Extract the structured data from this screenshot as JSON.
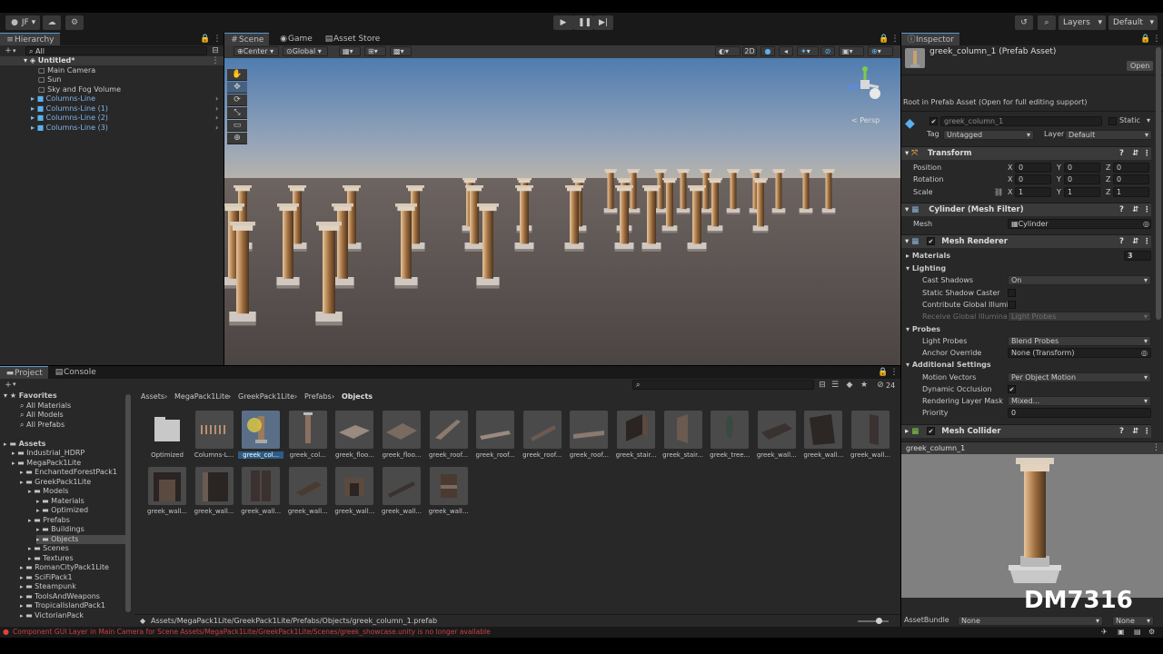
{
  "topbar": {
    "account": "JF",
    "layers": "Layers",
    "layout": "Default"
  },
  "hierarchy": {
    "tab": "Hierarchy",
    "search_placeholder": "All",
    "scene": "Untitled*",
    "items": [
      "Main Camera",
      "Sun",
      "Sky and Fog Volume",
      "Columns-Line",
      "Columns-Line (1)",
      "Columns-Line (2)",
      "Columns-Line (3)"
    ]
  },
  "scene": {
    "tabs": [
      "Scene",
      "Game",
      "Asset Store"
    ],
    "pivot": "Center",
    "space": "Global",
    "mode2d": "2D",
    "gizmo_label": "< Persp"
  },
  "project": {
    "tabs": [
      "Project",
      "Console"
    ],
    "asset_count": "24",
    "breadcrumb": [
      "Assets",
      "MegaPack1Lite",
      "GreekPack1Lite",
      "Prefabs",
      "Objects"
    ],
    "favorites": {
      "label": "Favorites",
      "items": [
        "All Materials",
        "All Models",
        "All Prefabs"
      ]
    },
    "tree": [
      {
        "label": "Assets",
        "indent": 0
      },
      {
        "label": "Industrial_HDRP",
        "indent": 1
      },
      {
        "label": "MegaPack1Lite",
        "indent": 1
      },
      {
        "label": "EnchantedForestPack1",
        "indent": 2
      },
      {
        "label": "GreekPack1Lite",
        "indent": 2
      },
      {
        "label": "Models",
        "indent": 3
      },
      {
        "label": "Materials",
        "indent": 4
      },
      {
        "label": "Optimized",
        "indent": 4
      },
      {
        "label": "Prefabs",
        "indent": 3
      },
      {
        "label": "Buildings",
        "indent": 4
      },
      {
        "label": "Objects",
        "indent": 4
      },
      {
        "label": "Scenes",
        "indent": 3
      },
      {
        "label": "Textures",
        "indent": 3
      },
      {
        "label": "RomanCityPack1Lite",
        "indent": 2
      },
      {
        "label": "SciFiPack1",
        "indent": 2
      },
      {
        "label": "Steampunk",
        "indent": 2
      },
      {
        "label": "ToolsAndWeapons",
        "indent": 2
      },
      {
        "label": "TropicalIslandPack1",
        "indent": 2
      },
      {
        "label": "VictorianPack",
        "indent": 2
      }
    ],
    "assets_row1": [
      "Optimized",
      "Columns-L...",
      "greek_col...",
      "greek_col...",
      "greek_floo...",
      "greek_floo...",
      "greek_roof...",
      "greek_roof...",
      "greek_roof...",
      "greek_roof...",
      "greek_stair...",
      "greek_stair...",
      "greek_tree...",
      "greek_wall...",
      "greek_wall...",
      "greek_wall..."
    ],
    "assets_row2": [
      "greek_wall...",
      "greek_wall...",
      "greek_wall...",
      "greek_wall...",
      "greek_wall...",
      "greek_wall...",
      "greek_wall..."
    ],
    "selected_path": "Assets/MegaPack1Lite/GreekPack1Lite/Prefabs/Objects/greek_column_1.prefab"
  },
  "inspector": {
    "tab": "Inspector",
    "asset_title": "greek_column_1 (Prefab Asset)",
    "open_button": "Open",
    "root_note": "Root in Prefab Asset (Open for full editing support)",
    "object_name": "greek_column_1",
    "static_label": "Static",
    "tag_label": "Tag",
    "tag_value": "Untagged",
    "layer_label": "Layer",
    "layer_value": "Default",
    "transform": {
      "title": "Transform",
      "rows": [
        {
          "label": "Position",
          "x": "0",
          "y": "0",
          "z": "0"
        },
        {
          "label": "Rotation",
          "x": "0",
          "y": "0",
          "z": "0"
        },
        {
          "label": "Scale",
          "x": "1",
          "y": "1",
          "z": "1"
        }
      ]
    },
    "axis": {
      "x": "X",
      "y": "Y",
      "z": "Z"
    },
    "mesh_filter": {
      "title": "Cylinder (Mesh Filter)",
      "mesh_label": "Mesh",
      "mesh_value": "Cylinder"
    },
    "mesh_renderer": {
      "title": "Mesh Renderer",
      "materials_label": "Materials",
      "materials_count": "3",
      "lighting_label": "Lighting",
      "cast_shadows_label": "Cast Shadows",
      "cast_shadows_value": "On",
      "static_shadow_label": "Static Shadow Caster",
      "contribute_gi_label": "Contribute Global Illumin",
      "receive_gi_label": "Receive Global Illuminati",
      "receive_gi_value": "Light Probes",
      "probes_label": "Probes",
      "light_probes_label": "Light Probes",
      "light_probes_value": "Blend Probes",
      "anchor_label": "Anchor Override",
      "anchor_value": "None (Transform)",
      "additional_label": "Additional Settings",
      "motion_label": "Motion Vectors",
      "motion_value": "Per Object Motion",
      "occlusion_label": "Dynamic Occlusion",
      "rendering_layer_label": "Rendering Layer Mask",
      "rendering_layer_value": "Mixed...",
      "priority_label": "Priority",
      "priority_value": "0"
    },
    "mesh_collider": {
      "title": "Mesh Collider"
    },
    "preview_title": "greek_column_1",
    "assetbundle_label": "AssetBundle",
    "assetbundle_value": "None",
    "assetbundle_variant": "None"
  },
  "watermark": "DM7316",
  "status_message": "Component GUI Layer in Main Camera for Scene Assets/MegaPack1Lite/GreekPack1Lite/Scenes/greek_showcase.unity is no longer available"
}
